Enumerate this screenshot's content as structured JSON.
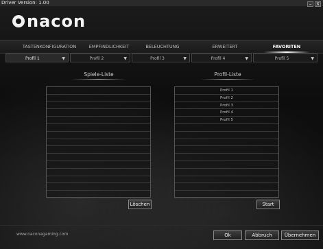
{
  "window": {
    "title": "Driver Version: 1.00",
    "minimize_label": "–",
    "close_label": "X"
  },
  "brand": {
    "logo_text": "nacon"
  },
  "tabs": [
    {
      "label": "TASTENKONFIGURATION"
    },
    {
      "label": "EMPFINDLICHKEIT"
    },
    {
      "label": "BELEUCHTUNG"
    },
    {
      "label": "ERWEITERT"
    },
    {
      "label": "FAVORITEN"
    }
  ],
  "active_tab": "FAVORITEN",
  "profiles": [
    {
      "label": "Profil 1"
    },
    {
      "label": "Profil 2"
    },
    {
      "label": "Profil 3"
    },
    {
      "label": "Profil 4"
    },
    {
      "label": "Profil 5"
    }
  ],
  "games_list": {
    "title": "Spiele-Liste",
    "items": [
      "",
      "",
      "",
      "",
      "",
      "",
      "",
      "",
      "",
      "",
      "",
      "",
      "",
      "",
      ""
    ]
  },
  "profile_list": {
    "title": "Profil-Liste",
    "items": [
      "Profil 1",
      "Profil 2",
      "Profil 3",
      "Profil 4",
      "Profil 5",
      "",
      "",
      "",
      "",
      "",
      "",
      "",
      "",
      "",
      ""
    ]
  },
  "buttons": {
    "delete": "Löschen",
    "start": "Start",
    "ok": "Ok",
    "cancel": "Abbruch",
    "apply": "Übernehmen"
  },
  "footer": {
    "url": "www.naconagaming.com"
  },
  "colors": {
    "background": "#0e0e0e",
    "accent": "#ffffff",
    "border": "#555555"
  }
}
